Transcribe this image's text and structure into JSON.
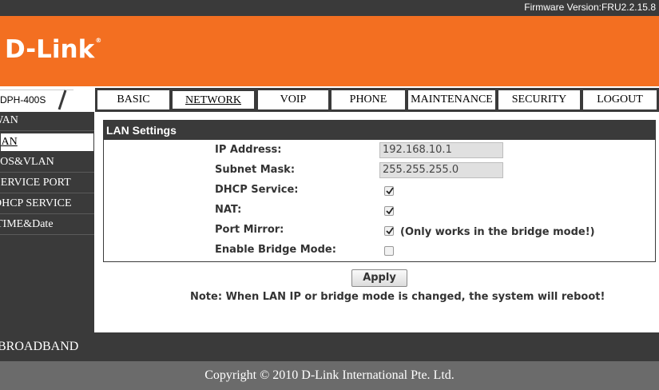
{
  "header": {
    "firmware": "Firmware Version:FRU2.2.15.8",
    "logo": "D-Link",
    "logo_mark": "®",
    "model": "DPH-400S"
  },
  "nav": {
    "tabs": [
      {
        "label": "BASIC"
      },
      {
        "label": "NETWORK"
      },
      {
        "label": "VOIP"
      },
      {
        "label": "PHONE"
      },
      {
        "label": "MAINTENANCE"
      },
      {
        "label": "SECURITY"
      },
      {
        "label": "LOGOUT"
      }
    ],
    "active": "NETWORK"
  },
  "sidebar": {
    "items": [
      {
        "label": "WAN"
      },
      {
        "label": "LAN"
      },
      {
        "label": "QOS&VLAN"
      },
      {
        "label": "SERVICE PORT"
      },
      {
        "label": "DHCP SERVICE"
      },
      {
        "label": "TIME&Date"
      }
    ],
    "active": "LAN"
  },
  "lan": {
    "title": "LAN Settings",
    "ip_label": "IP Address:",
    "ip_value": "192.168.10.1",
    "mask_label": "Subnet Mask:",
    "mask_value": "255.255.255.0",
    "dhcp_label": "DHCP Service:",
    "dhcp_checked": true,
    "nat_label": "NAT:",
    "nat_checked": true,
    "mirror_label": "Port Mirror:",
    "mirror_checked": true,
    "mirror_note": "(Only works in the bridge mode!)",
    "bridge_label": "Enable Bridge Mode:",
    "bridge_checked": false
  },
  "actions": {
    "apply": "Apply",
    "note": "Note: When LAN IP or bridge mode is changed, the system will reboot!"
  },
  "section": {
    "broadband": "BROADBAND"
  },
  "footer": {
    "copyright": "Copyright © 2010 D-Link International Pte. Ltd."
  },
  "colors": {
    "brand_orange": "#f36f21",
    "dark_bar": "#3a3a3a",
    "footer_gray": "#6b6b6b"
  }
}
